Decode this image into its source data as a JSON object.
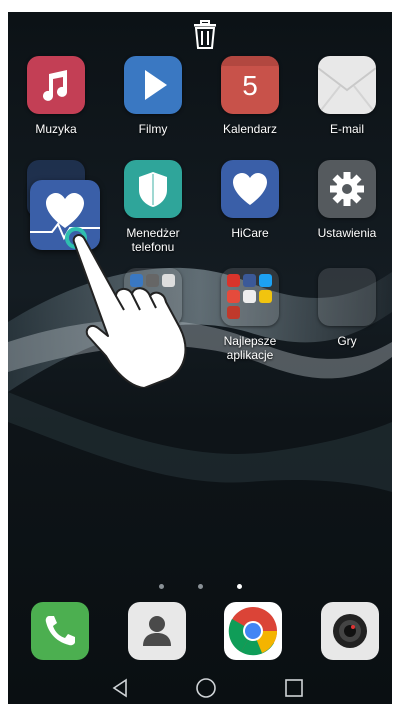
{
  "status": {
    "delete_target": "trash-icon"
  },
  "apps_row1": [
    {
      "label": "Muzyka",
      "icon": "music-note-icon",
      "color": "#c33f55"
    },
    {
      "label": "Filmy",
      "icon": "play-icon",
      "color": "#3a78c2"
    },
    {
      "label": "Kalendarz",
      "icon": "calendar-icon",
      "color": "#c8524a",
      "day": "5"
    },
    {
      "label": "E-mail",
      "icon": "envelope-icon",
      "color": "#e8e8e8"
    }
  ],
  "apps_row2": [
    {
      "label": "",
      "icon": "health-heart-icon",
      "color": "#3a5fa8"
    },
    {
      "label": "Menedżer telefonu",
      "icon": "shield-icon",
      "color": "#2fa59a"
    },
    {
      "label": "HiCare",
      "icon": "heart-icon",
      "color": "#3a5fa8"
    },
    {
      "label": "Ustawienia",
      "icon": "gear-icon",
      "color": "#555a5e"
    }
  ],
  "folders_row3": [
    {
      "label": "Najlepsze aplikacje",
      "icon": "folder-icon"
    },
    {
      "label": "Gry",
      "icon": "folder-icon"
    }
  ],
  "dock": [
    {
      "name": "phone",
      "icon": "phone-icon",
      "color": "#4caf50"
    },
    {
      "name": "contacts",
      "icon": "contacts-icon",
      "color": "#e8e8e8"
    },
    {
      "name": "browser",
      "icon": "chrome-icon",
      "color": "#ffffff"
    },
    {
      "name": "camera",
      "icon": "camera-icon",
      "color": "#e8e8e8"
    }
  ],
  "pages": {
    "count": 3,
    "active": 3
  },
  "navbar": {
    "back": "back-icon",
    "home": "home-icon",
    "recents": "recents-icon"
  }
}
